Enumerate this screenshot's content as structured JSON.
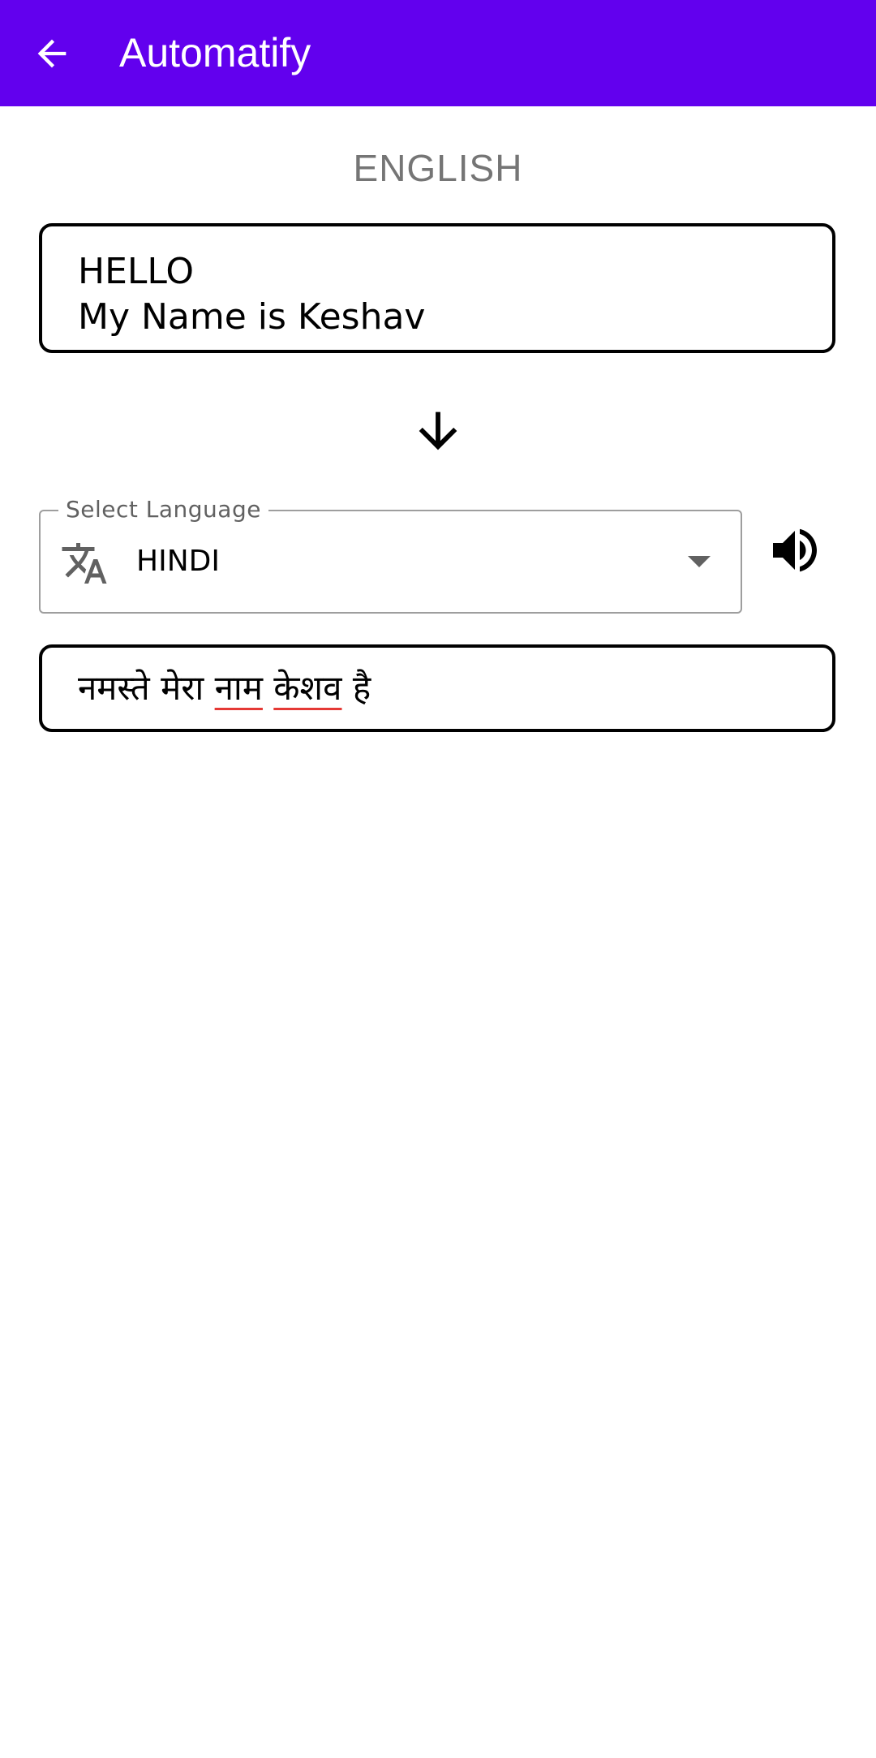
{
  "app_bar": {
    "title": "Automatify",
    "back_icon": "arrow-back-icon",
    "color": "#6200EE"
  },
  "source": {
    "language": "ENGLISH",
    "text_lines": [
      "HELLO",
      "My Name is Keshav"
    ]
  },
  "direction_icon": "arrow-down-icon",
  "target": {
    "select_label": "Select Language",
    "selected_language": "HINDI",
    "translate_icon": "translate-icon",
    "dropdown_icon": "dropdown-arrow-icon",
    "speaker_icon": "volume-up-icon"
  },
  "output": {
    "words": [
      {
        "text": "नमस्ते",
        "misspelled": false
      },
      {
        "text": "मेरा",
        "misspelled": false
      },
      {
        "text": "नाम",
        "misspelled": true
      },
      {
        "text": "केशव",
        "misspelled": true
      },
      {
        "text": "है",
        "misspelled": false
      }
    ]
  }
}
